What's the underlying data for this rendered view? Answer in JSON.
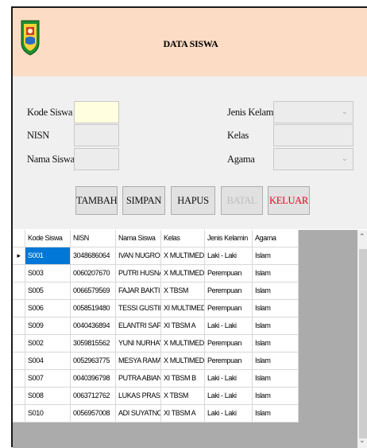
{
  "header": {
    "title": "DATA SISWA",
    "logo_icon": "regional-crest-icon"
  },
  "form": {
    "kode_siswa_label": "Kode Siswa",
    "nisn_label": "NISN",
    "nama_siswa_label": "Nama Siswa",
    "jenis_kelamin_label": "Jenis Kelamin",
    "kelas_label": "Kelas",
    "agama_label": "Agama",
    "kode_siswa_value": "",
    "nisn_value": "",
    "nama_siswa_value": "",
    "jenis_kelamin_value": "",
    "kelas_value": "",
    "agama_value": ""
  },
  "buttons": {
    "tambah": "TAMBAH",
    "simpan": "SIMPAN",
    "hapus": "HAPUS",
    "batal": "BATAL",
    "keluar": "KELUAR"
  },
  "grid": {
    "columns": [
      "Kode Siswa",
      "NISN",
      "Nama Siswa",
      "Kelas",
      "Jenis Kelamin",
      "Agama"
    ],
    "row_indicator": "▸",
    "rows": [
      [
        "S001",
        "3048686064",
        "IVAN NUGROH...",
        "X MULTIMEDIA A",
        "Laki - Laki",
        "Islam"
      ],
      [
        "S003",
        "0060207670",
        "PUTRI HUSNA ...",
        "X MULTIMEDIA A",
        "Perempuan",
        "Islam"
      ],
      [
        "S005",
        "0066579569",
        "FAJAR BAKTI",
        "X TBSM",
        "Perempuan",
        "Islam"
      ],
      [
        "S006",
        "0058519480",
        "TESSI GUSTINA",
        "XI MULTIMEDIA",
        "Perempuan",
        "Islam"
      ],
      [
        "S009",
        "0040436894",
        "ELANTRI SAPUA",
        "XI TBSM A",
        "Laki - Laki",
        "Islam"
      ],
      [
        "S002",
        "3059815562",
        "YUNI NURHAYATI",
        "X MULTIMEDIA A",
        "Perempuan",
        "Islam"
      ],
      [
        "S004",
        "0052963775",
        "MESYA RAMAD...",
        "X MULTIMEDIA B",
        "Perempuan",
        "Islam"
      ],
      [
        "S007",
        "0040396798",
        "PUTRA ABIANS...",
        "XI TBSM B",
        "Laki - Laki",
        "Islam"
      ],
      [
        "S008",
        "0063712762",
        "LUKAS PRASET...",
        "X TBSM",
        "Laki - Laki",
        "Islam"
      ],
      [
        "S010",
        "0056957008",
        "ADI SUYATNO",
        "XI TBSM A",
        "Laki - Laki",
        "Islam"
      ]
    ]
  }
}
